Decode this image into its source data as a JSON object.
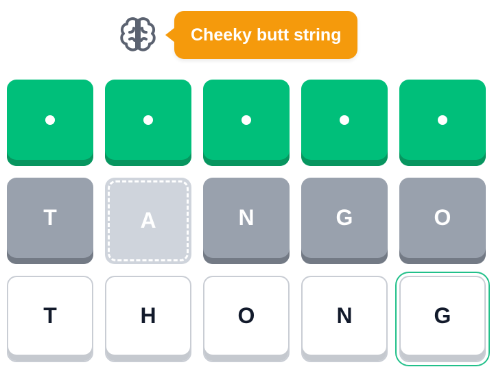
{
  "hint": {
    "icon": "brain-icon",
    "text": "Cheeky butt string",
    "color": "#f59a0c"
  },
  "colors": {
    "correct": "#00bf7a",
    "revealed": "#99a1ad",
    "hint_tile": "#cfd4dc",
    "input": "#ffffff",
    "active_outline": "#22c08a"
  },
  "rows": [
    {
      "type": "solution",
      "tiles": [
        "",
        "",
        "",
        "",
        ""
      ]
    },
    {
      "type": "revealed",
      "tiles": [
        "T",
        "A",
        "N",
        "G",
        "O"
      ]
    },
    {
      "type": "input",
      "tiles": [
        "T",
        "H",
        "O",
        "N",
        "G"
      ]
    }
  ]
}
